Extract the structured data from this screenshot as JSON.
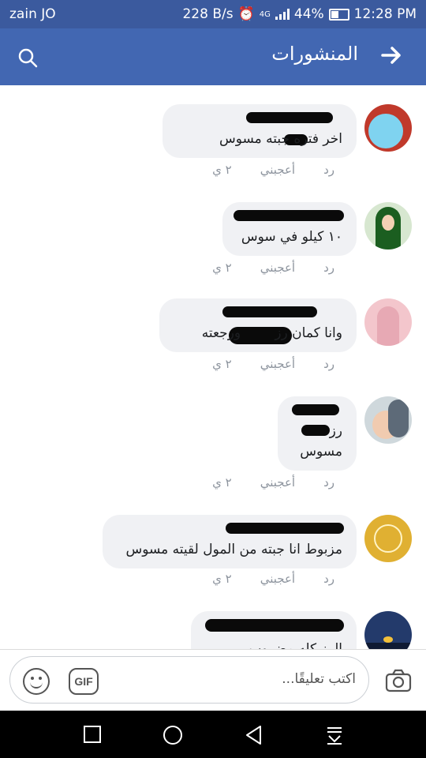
{
  "status": {
    "carrier": "zain JO",
    "speed": "228 B/s",
    "network": "4G",
    "battery": "44%",
    "time": "12:28 PM"
  },
  "header": {
    "title": "المنشورات",
    "back_icon": "arrow-right-icon",
    "search_icon": "search-icon"
  },
  "comments": [
    {
      "lines": [
        "اخر فتره جبته مسوس"
      ],
      "time": "٢ ي",
      "like": "أعجبني",
      "reply": "رد",
      "avatar_color": "#7fd3f0"
    },
    {
      "lines": [
        "١٠ كيلو  في سوس"
      ],
      "time": "٢ ي",
      "like": "أعجبني",
      "reply": "رد",
      "avatar_color": "#2e7d32"
    },
    {
      "lines": [
        "وانا كمان رز        ورجعته"
      ],
      "time": "٢ ي",
      "like": "أعجبني",
      "reply": "رد",
      "avatar_color": "#e7a9b4"
    },
    {
      "lines": [
        "رز",
        "مسوس"
      ],
      "time": "٢ ي",
      "like": "أعجبني",
      "reply": "رد",
      "avatar_color": "#9aa6b5"
    },
    {
      "lines": [
        "مزبوط انا جبته من المول لقيته مسوس"
      ],
      "time": "٢ ي",
      "like": "أعجبني",
      "reply": "رد",
      "avatar_color": "#d4a21c"
    },
    {
      "lines": [
        "الرز كله مضروب"
      ],
      "time": "",
      "like": "",
      "reply": "",
      "avatar_color": "#233a6b"
    }
  ],
  "composer": {
    "placeholder": "اكتب تعليقًا...",
    "gif_label": "GIF"
  }
}
